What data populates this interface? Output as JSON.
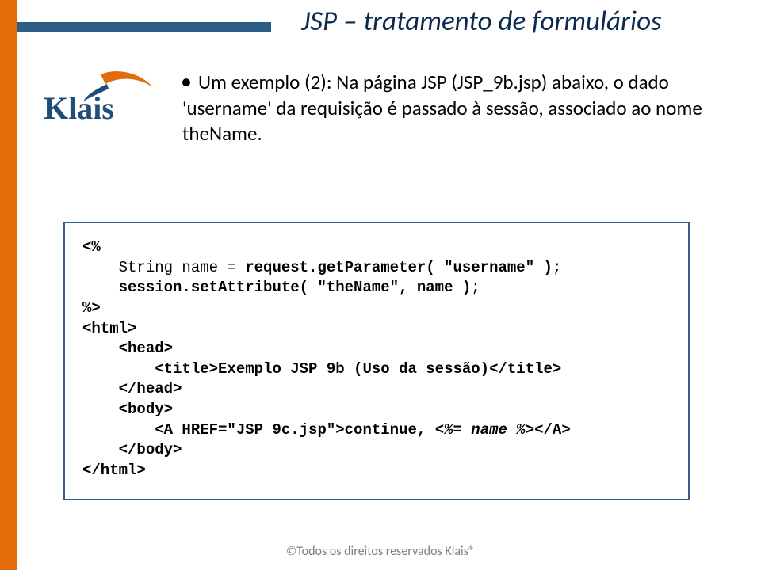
{
  "title": "JSP –  tratamento de formulários",
  "logo_text": "Klais",
  "bullet": "Um exemplo (2): Na página JSP (JSP_9b.jsp) abaixo, o dado 'username' da requisição é passado à sessão, associado ao nome theName.",
  "code": {
    "l1": "<%",
    "l2a": "    String name = ",
    "l2b": "request.getParameter( \"username\" )",
    "l2c": ";",
    "l3a": "    ",
    "l3b": "session.setAttribute( \"theName\", name )",
    "l3c": ";",
    "l4": "%>",
    "l5": "<html>",
    "l6": "    <head>",
    "l7": "        <title>Exemplo JSP_9b (Uso da sessão)</title>",
    "l8": "    </head>",
    "l9": "    <body>",
    "l10a": "        <A HREF=\"JSP_9c.jsp\">continue, ",
    "l10b": "<%= name %>",
    "l10c": "</A>",
    "l11": "    </body>",
    "l12": "</html>"
  },
  "footer": "©Todos os direitos reservados Klais®"
}
